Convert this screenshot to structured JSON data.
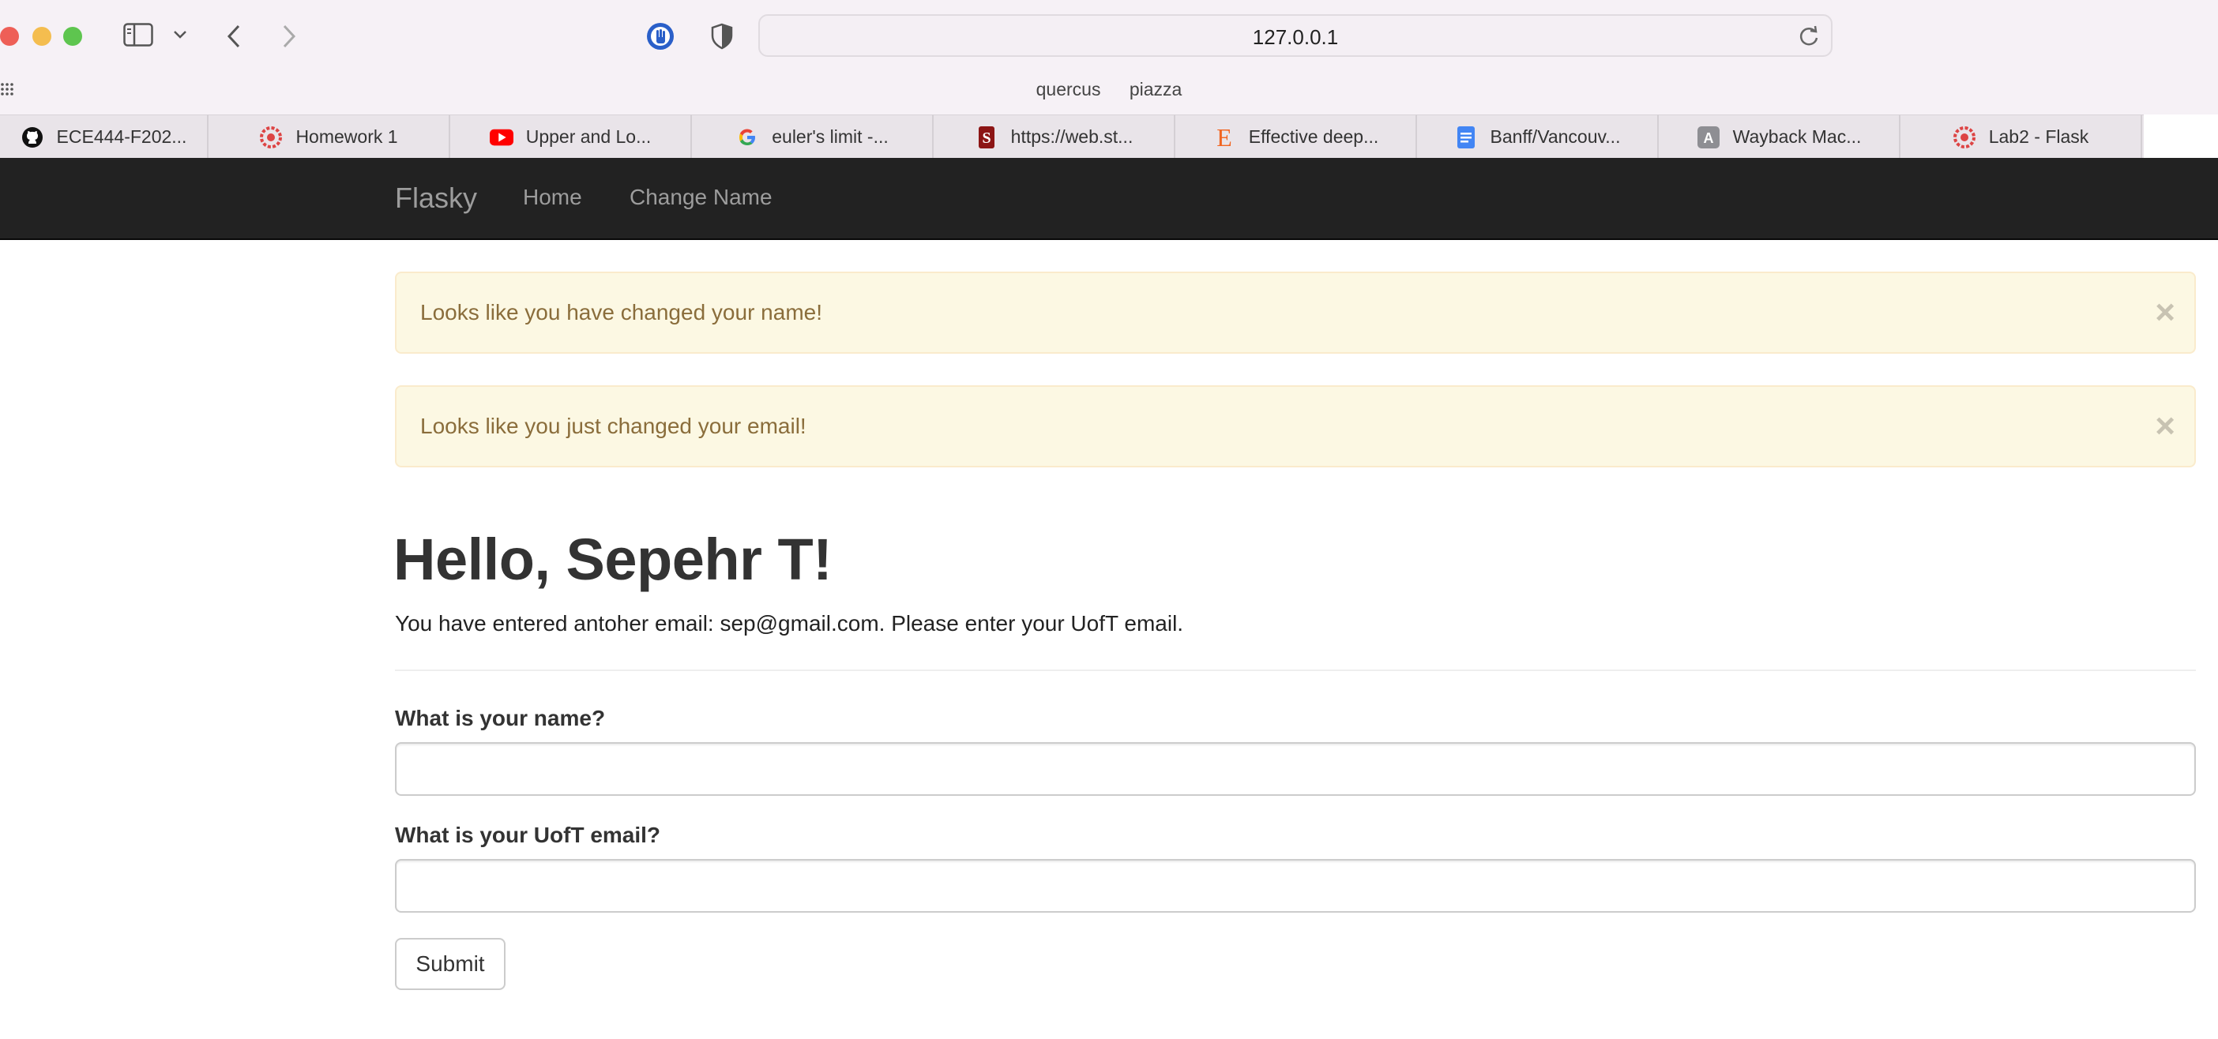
{
  "browser": {
    "url": "127.0.0.1",
    "favorites": [
      "quercus",
      "piazza"
    ],
    "tabs": [
      {
        "label": "ECE444-F202...",
        "icon": "github-icon"
      },
      {
        "label": "Homework 1",
        "icon": "uoft-logo-icon"
      },
      {
        "label": "Upper and Lo...",
        "icon": "youtube-icon"
      },
      {
        "label": "euler's limit -...",
        "icon": "google-icon"
      },
      {
        "label": "https://web.st...",
        "icon": "stanford-icon"
      },
      {
        "label": "Effective deep...",
        "icon": "etsy-icon"
      },
      {
        "label": "Banff/Vancouv...",
        "icon": "google-docs-icon"
      },
      {
        "label": "Wayback Mac...",
        "icon": "letter-a-icon"
      },
      {
        "label": "Lab2 - Flask",
        "icon": "uoft-logo-icon"
      }
    ]
  },
  "navbar": {
    "brand": "Flasky",
    "links": [
      "Home",
      "Change Name"
    ]
  },
  "alerts": [
    {
      "message": "Looks like you have changed your name!",
      "close": "×"
    },
    {
      "message": "Looks like you just changed your email!",
      "close": "×"
    }
  ],
  "page": {
    "heading": "Hello, Sepehr T!",
    "note": "You have entered antoher email: sep@gmail.com. Please enter your UofT email."
  },
  "form": {
    "name_label": "What is your name?",
    "name_value": "",
    "email_label": "What is your UofT email?",
    "email_value": "",
    "submit_label": "Submit"
  },
  "colors": {
    "navbar_bg": "#222222",
    "alert_bg": "#fcf8e3",
    "alert_text": "#8a6d3b"
  }
}
